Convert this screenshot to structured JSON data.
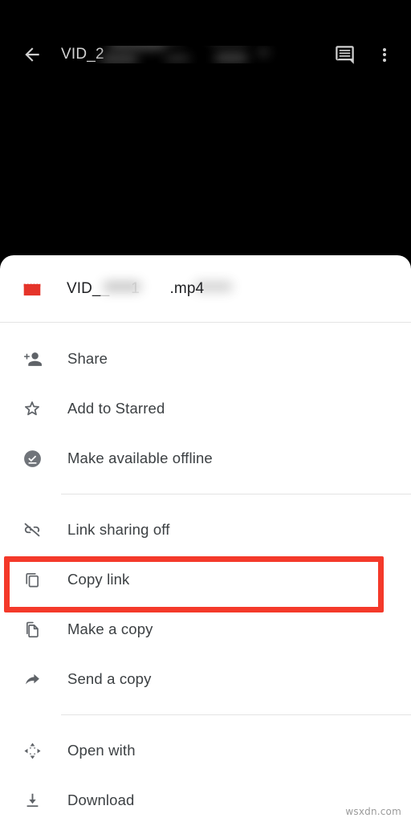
{
  "viewer": {
    "title_visible": "VID_2",
    "back_icon": "arrow-back-icon",
    "comment_icon": "comment-icon",
    "overflow_icon": "more-vert-icon",
    "background_color": "#000000"
  },
  "sheet": {
    "file": {
      "icon": "video-clapperboard-icon",
      "icon_color": "#E5342A",
      "name_prefix": "VID_",
      "name_redacted_mid": "1",
      "name_suffix": ".mp4"
    },
    "groups": [
      {
        "items": [
          {
            "label": "Share",
            "icon": "person-add-icon"
          },
          {
            "label": "Add to Starred",
            "icon": "star-outline-icon"
          },
          {
            "label": "Make available offline",
            "icon": "offline-pin-icon"
          }
        ]
      },
      {
        "items": [
          {
            "label": "Link sharing off",
            "icon": "link-off-icon"
          },
          {
            "label": "Copy link",
            "icon": "copy-icon"
          },
          {
            "label": "Make a copy",
            "icon": "file-copy-icon"
          },
          {
            "label": "Send a copy",
            "icon": "send-arrow-icon"
          }
        ]
      },
      {
        "items": [
          {
            "label": "Open with",
            "icon": "open-with-icon"
          },
          {
            "label": "Download",
            "icon": "download-icon"
          }
        ]
      }
    ]
  },
  "annotation": {
    "highlight_color": "#F4392A",
    "highlighted_item": "Copy link"
  },
  "watermark": {
    "text": "wsxdn.com"
  }
}
